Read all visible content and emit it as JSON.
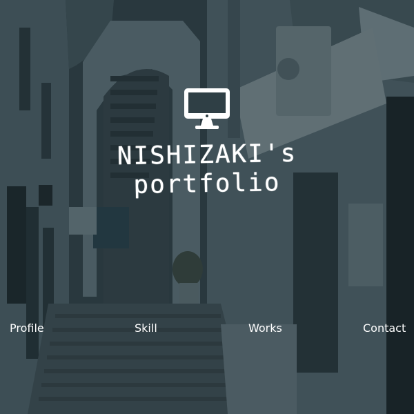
{
  "hero": {
    "background": "whitewashed stone alley with stairs and arched passage",
    "overlay_color": "#14232899",
    "icon": "desktop-monitor-icon",
    "title_line1": "NISHIZAKI's",
    "title_line2": "portfolio"
  },
  "nav": {
    "items": [
      {
        "label": "Profile"
      },
      {
        "label": "Skill"
      },
      {
        "label": "Works"
      },
      {
        "label": "Contact"
      }
    ]
  }
}
